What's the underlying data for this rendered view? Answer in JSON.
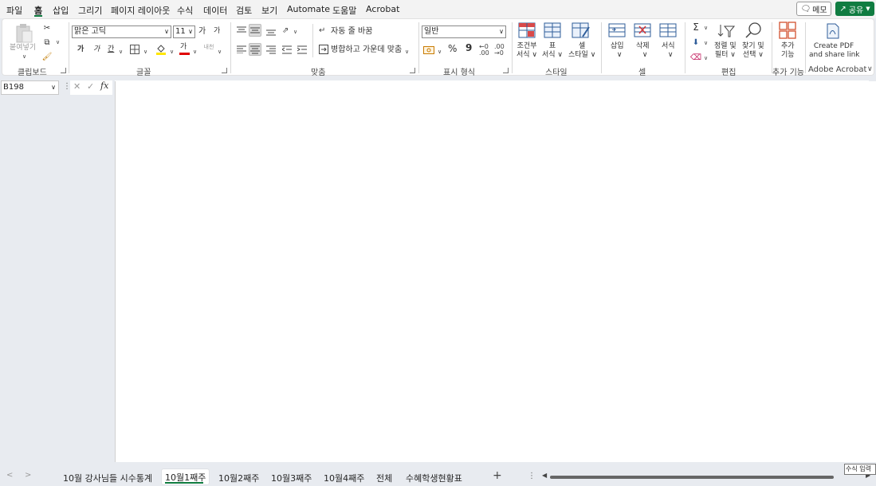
{
  "menu": {
    "items": [
      "파일",
      "홈",
      "삽입",
      "그리기",
      "페이지 레이아웃",
      "수식",
      "데이터",
      "검토",
      "보기",
      "Automate",
      "도움말",
      "Acrobat"
    ],
    "active": "홈",
    "memo_label": "메모",
    "share_label": "공유"
  },
  "ribbon": {
    "clipboard": {
      "paste_label": "붙여넣기",
      "group_label": "클립보드"
    },
    "font": {
      "font_name": "맑은 고딕",
      "font_size": "11",
      "grow": "가",
      "shrink": "가",
      "bold": "가",
      "italic": "가",
      "underline": "간",
      "color_glyph": "가",
      "phonetic": "내천",
      "group_label": "글꼴"
    },
    "alignment": {
      "wrap_label": "자동 줄 바꿈",
      "merge_label": "병합하고 가운데 맞춤",
      "group_label": "맞춤"
    },
    "number": {
      "format": "일반",
      "percent": "%",
      "comma": "9",
      "group_label": "표시 형식"
    },
    "styles": {
      "conditional": [
        "조건부",
        "서식"
      ],
      "table": [
        "표",
        "서식"
      ],
      "cell": [
        "셀",
        "스타일"
      ],
      "group_label": "스타일"
    },
    "cells": {
      "insert": "삽입",
      "delete": "삭제",
      "format": "서식",
      "group_label": "셀"
    },
    "editing": {
      "sort": [
        "정렬 및",
        "필터"
      ],
      "find": [
        "찾기 및",
        "선택"
      ],
      "group_label": "편집"
    },
    "addins": {
      "label": [
        "추가",
        "기능"
      ],
      "group_label": "추가 기능"
    },
    "acrobat": {
      "label": [
        "Create PDF",
        "and share link"
      ],
      "group_label": "Adobe Acrobat"
    }
  },
  "formula": {
    "name_box": "B198",
    "fx": "fx",
    "value": ""
  },
  "tabs": {
    "sheets": [
      "10월 강사님들 시수통계",
      "10월1째주",
      "10월2째주",
      "10월3째주",
      "10월4째주",
      "전체",
      "수혜학생현황표"
    ],
    "active_index": 1,
    "add_label": "+",
    "more_label": "⋮"
  },
  "status": {
    "tooltip": "수식 입력"
  },
  "colors": {
    "accent": "#107c41",
    "ribbon_bg": "#ffffff",
    "app_bg": "#e8ebf0"
  }
}
